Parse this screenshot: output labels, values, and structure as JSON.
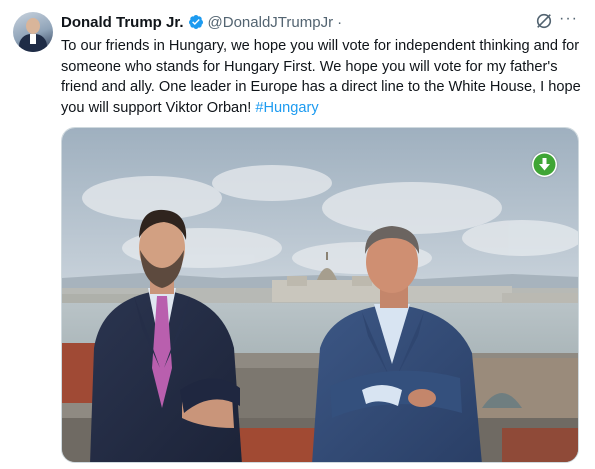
{
  "author": {
    "name": "Donald Trump Jr.",
    "handle": "@DonaldJTrumpJr",
    "separator": "·"
  },
  "tweet": {
    "text": "To our friends in Hungary, we hope you will vote for independent thinking and for someone who stands for Hungary First. We hope you will vote for my father's friend and ally. One leader in Europe has a direct line to the White House, I hope you will support Viktor Orban! ",
    "hashtag": "#Hungary"
  },
  "icons": {
    "verified": "verified-badge-icon",
    "grok": "grok-icon",
    "more": "more-options-icon",
    "download": "download-icon"
  },
  "colors": {
    "accent": "#1d9bf0",
    "text": "#0f1419",
    "muted": "#536471",
    "download_green": "#3fa535"
  },
  "more_label": "···"
}
